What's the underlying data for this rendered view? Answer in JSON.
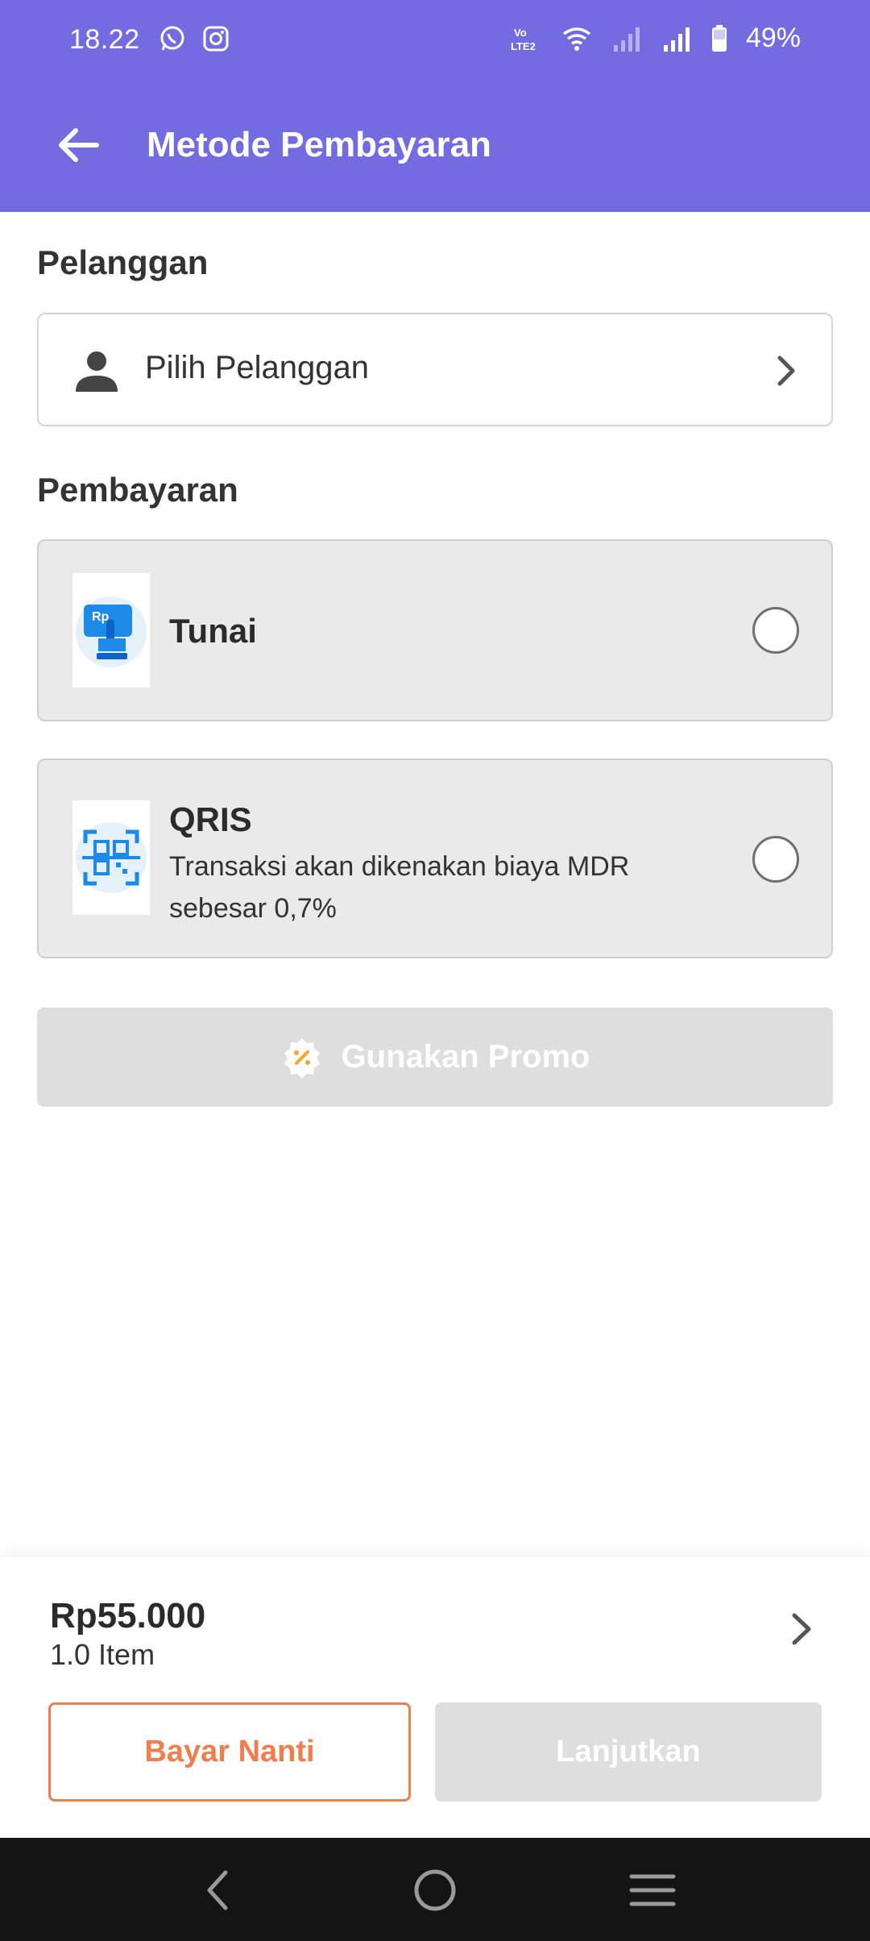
{
  "status_bar": {
    "time": "18.22",
    "battery": "49%",
    "icons": [
      "whatsapp-icon",
      "instagram-icon",
      "volte-icon",
      "wifi-icon",
      "signal-icon",
      "signal-icon",
      "battery-icon"
    ]
  },
  "header": {
    "title": "Metode Pembayaran",
    "back_icon": "arrow-left-icon"
  },
  "customer": {
    "section_title": "Pelanggan",
    "select_label": "Pilih Pelanggan"
  },
  "payment": {
    "section_title": "Pembayaran",
    "methods": [
      {
        "name": "Tunai",
        "description": "",
        "icon": "cash-rp-icon",
        "selected": false
      },
      {
        "name": "QRIS",
        "description": "Transaksi akan dikenakan biaya MDR sebesar 0,7%",
        "icon": "qris-icon",
        "selected": false
      }
    ]
  },
  "promo": {
    "label": "Gunakan Promo"
  },
  "summary": {
    "total": "Rp55.000",
    "items": "1.0 Item",
    "pay_later_label": "Bayar Nanti",
    "continue_label": "Lanjutkan"
  },
  "colors": {
    "primary": "#736be0",
    "accent": "#f07d4b",
    "disabled": "#dedede"
  }
}
